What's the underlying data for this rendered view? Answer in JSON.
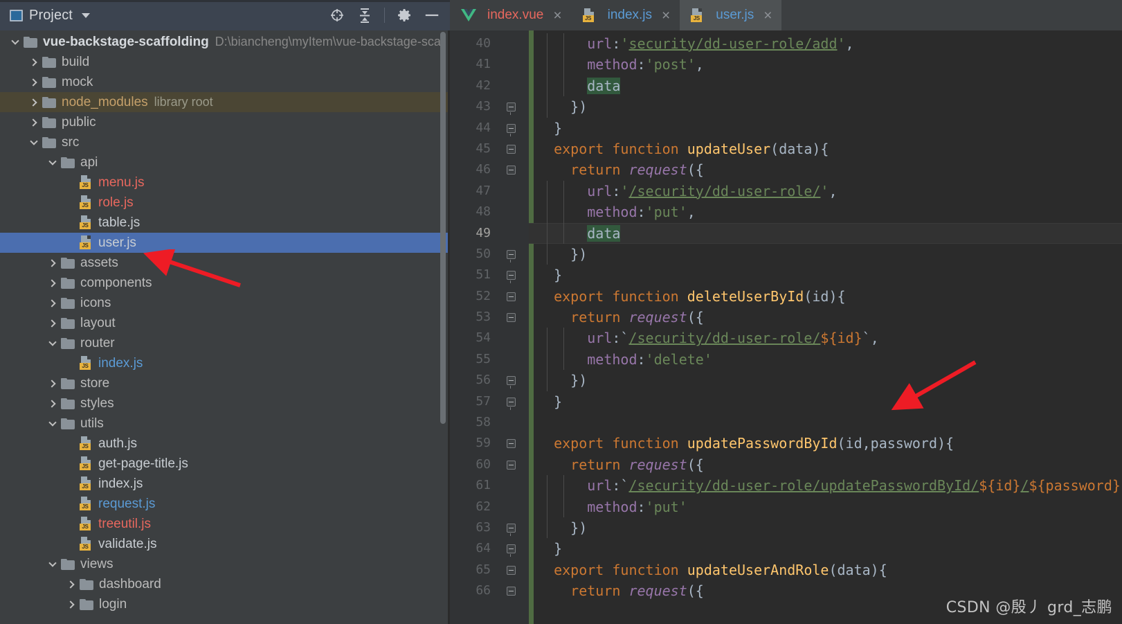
{
  "panel": {
    "title": "Project",
    "icons": {
      "project_icon": "project-icon",
      "dropdown": "chevron-down-icon",
      "locate": "locate-target-icon",
      "collapse_all": "collapse-all-icon",
      "settings": "gear-icon",
      "hide": "minimize-icon"
    }
  },
  "tree": [
    {
      "depth": 0,
      "arrow": "down",
      "icon": "folder",
      "label": "vue-backstage-scaffolding",
      "bold": true,
      "sub": "D:\\biancheng\\myItem\\vue-backstage-sca",
      "color": "white"
    },
    {
      "depth": 1,
      "arrow": "right",
      "icon": "folder",
      "label": "build",
      "color": "plain"
    },
    {
      "depth": 1,
      "arrow": "right",
      "icon": "folder",
      "label": "mock",
      "color": "plain"
    },
    {
      "depth": 1,
      "arrow": "right",
      "icon": "folder",
      "label": "node_modules",
      "color": "yellow",
      "sub": "library root",
      "highlight": "libroot"
    },
    {
      "depth": 1,
      "arrow": "right",
      "icon": "folder",
      "label": "public",
      "color": "plain"
    },
    {
      "depth": 1,
      "arrow": "down",
      "icon": "folder",
      "label": "src",
      "color": "plain"
    },
    {
      "depth": 2,
      "arrow": "down",
      "icon": "folder",
      "label": "api",
      "color": "plain"
    },
    {
      "depth": 3,
      "arrow": "none",
      "icon": "js",
      "label": "menu.js",
      "color": "red"
    },
    {
      "depth": 3,
      "arrow": "none",
      "icon": "js",
      "label": "role.js",
      "color": "red"
    },
    {
      "depth": 3,
      "arrow": "none",
      "icon": "js",
      "label": "table.js",
      "color": "white"
    },
    {
      "depth": 3,
      "arrow": "none",
      "icon": "js",
      "label": "user.js",
      "color": "white",
      "selected": true
    },
    {
      "depth": 2,
      "arrow": "right",
      "icon": "folder",
      "label": "assets",
      "color": "plain"
    },
    {
      "depth": 2,
      "arrow": "right",
      "icon": "folder",
      "label": "components",
      "color": "plain"
    },
    {
      "depth": 2,
      "arrow": "right",
      "icon": "folder",
      "label": "icons",
      "color": "plain"
    },
    {
      "depth": 2,
      "arrow": "right",
      "icon": "folder",
      "label": "layout",
      "color": "plain"
    },
    {
      "depth": 2,
      "arrow": "down",
      "icon": "folder",
      "label": "router",
      "color": "plain"
    },
    {
      "depth": 3,
      "arrow": "none",
      "icon": "js",
      "label": "index.js",
      "color": "blue"
    },
    {
      "depth": 2,
      "arrow": "right",
      "icon": "folder",
      "label": "store",
      "color": "plain"
    },
    {
      "depth": 2,
      "arrow": "right",
      "icon": "folder",
      "label": "styles",
      "color": "plain"
    },
    {
      "depth": 2,
      "arrow": "down",
      "icon": "folder",
      "label": "utils",
      "color": "plain"
    },
    {
      "depth": 3,
      "arrow": "none",
      "icon": "js",
      "label": "auth.js",
      "color": "white"
    },
    {
      "depth": 3,
      "arrow": "none",
      "icon": "js",
      "label": "get-page-title.js",
      "color": "white"
    },
    {
      "depth": 3,
      "arrow": "none",
      "icon": "js",
      "label": "index.js",
      "color": "white"
    },
    {
      "depth": 3,
      "arrow": "none",
      "icon": "js",
      "label": "request.js",
      "color": "blue"
    },
    {
      "depth": 3,
      "arrow": "none",
      "icon": "js",
      "label": "treeutil.js",
      "color": "red"
    },
    {
      "depth": 3,
      "arrow": "none",
      "icon": "js",
      "label": "validate.js",
      "color": "white"
    },
    {
      "depth": 2,
      "arrow": "down",
      "icon": "folder",
      "label": "views",
      "color": "plain"
    },
    {
      "depth": 3,
      "arrow": "right",
      "icon": "folder",
      "label": "dashboard",
      "color": "plain"
    },
    {
      "depth": 3,
      "arrow": "right",
      "icon": "folder",
      "label": "login",
      "color": "plain"
    }
  ],
  "tabs": [
    {
      "label": "index.vue",
      "icon": "vue-icon",
      "color": "red",
      "active": false,
      "close": "×"
    },
    {
      "label": "index.js",
      "icon": "js-icon",
      "color": "blue",
      "active": false,
      "close": "×"
    },
    {
      "label": "user.js",
      "icon": "js-icon",
      "color": "blue",
      "active": true,
      "close": "×"
    }
  ],
  "editor": {
    "first_line": 40,
    "current_line": 49,
    "lines": [
      {
        "n": 40,
        "indent": 3,
        "fold": "none",
        "guides": [
          1,
          2
        ],
        "tokens": [
          {
            "t": "url",
            "c": "prop"
          },
          {
            "t": ":",
            "c": "plain"
          },
          {
            "t": "'",
            "c": "str"
          },
          {
            "t": "security/dd-user-role/add",
            "c": "link"
          },
          {
            "t": "'",
            "c": "str"
          },
          {
            "t": ",",
            "c": "plain"
          }
        ]
      },
      {
        "n": 41,
        "indent": 3,
        "fold": "none",
        "guides": [
          1,
          2
        ],
        "tokens": [
          {
            "t": "method",
            "c": "prop"
          },
          {
            "t": ":",
            "c": "plain"
          },
          {
            "t": "'post'",
            "c": "str"
          },
          {
            "t": ",",
            "c": "plain"
          }
        ]
      },
      {
        "n": 42,
        "indent": 3,
        "fold": "none",
        "guides": [
          1,
          2
        ],
        "tokens": [
          {
            "t": "data",
            "c": "hl"
          }
        ]
      },
      {
        "n": 43,
        "indent": 2,
        "fold": "bracket",
        "guides": [
          1
        ],
        "tokens": [
          {
            "t": "})",
            "c": "plain"
          }
        ]
      },
      {
        "n": 44,
        "indent": 1,
        "fold": "bracket",
        "guides": [],
        "tokens": [
          {
            "t": "}",
            "c": "plain"
          }
        ]
      },
      {
        "n": 45,
        "indent": 1,
        "fold": "plain",
        "guides": [],
        "tokens": [
          {
            "t": "export function ",
            "c": "key"
          },
          {
            "t": "updateUser",
            "c": "fn"
          },
          {
            "t": "(data){",
            "c": "plain"
          }
        ]
      },
      {
        "n": 46,
        "indent": 2,
        "fold": "plain",
        "guides": [],
        "tokens": [
          {
            "t": "return ",
            "c": "key"
          },
          {
            "t": "request",
            "c": "italic"
          },
          {
            "t": "({",
            "c": "plain"
          }
        ]
      },
      {
        "n": 47,
        "indent": 3,
        "fold": "none",
        "guides": [
          1,
          2
        ],
        "tokens": [
          {
            "t": "url",
            "c": "prop"
          },
          {
            "t": ":",
            "c": "plain"
          },
          {
            "t": "'",
            "c": "str"
          },
          {
            "t": "/security/dd-user-role/",
            "c": "link"
          },
          {
            "t": "'",
            "c": "str"
          },
          {
            "t": ",",
            "c": "plain"
          }
        ]
      },
      {
        "n": 48,
        "indent": 3,
        "fold": "none",
        "guides": [
          1,
          2
        ],
        "tokens": [
          {
            "t": "method",
            "c": "prop"
          },
          {
            "t": ":",
            "c": "plain"
          },
          {
            "t": "'put'",
            "c": "str"
          },
          {
            "t": ",",
            "c": "plain"
          }
        ]
      },
      {
        "n": 49,
        "indent": 3,
        "fold": "none",
        "guides": [
          1,
          2
        ],
        "current": true,
        "tokens": [
          {
            "t": "data",
            "c": "hl"
          }
        ]
      },
      {
        "n": 50,
        "indent": 2,
        "fold": "bracket",
        "guides": [
          1
        ],
        "tokens": [
          {
            "t": "})",
            "c": "plain"
          }
        ]
      },
      {
        "n": 51,
        "indent": 1,
        "fold": "bracket",
        "guides": [],
        "tokens": [
          {
            "t": "}",
            "c": "plain"
          }
        ]
      },
      {
        "n": 52,
        "indent": 1,
        "fold": "plain",
        "guides": [],
        "tokens": [
          {
            "t": "export function ",
            "c": "key"
          },
          {
            "t": "deleteUserById",
            "c": "fn"
          },
          {
            "t": "(id){",
            "c": "plain"
          }
        ]
      },
      {
        "n": 53,
        "indent": 2,
        "fold": "plain",
        "guides": [],
        "tokens": [
          {
            "t": "return ",
            "c": "key"
          },
          {
            "t": "request",
            "c": "italic"
          },
          {
            "t": "({",
            "c": "plain"
          }
        ]
      },
      {
        "n": 54,
        "indent": 3,
        "fold": "none",
        "guides": [
          1,
          2
        ],
        "tokens": [
          {
            "t": "url",
            "c": "prop"
          },
          {
            "t": ":`",
            "c": "plain"
          },
          {
            "t": "/security/dd-user-role/",
            "c": "link"
          },
          {
            "t": "${id}",
            "c": "tmplvar"
          },
          {
            "t": "`",
            "c": "plain"
          },
          {
            "t": ",",
            "c": "plain"
          }
        ]
      },
      {
        "n": 55,
        "indent": 3,
        "fold": "none",
        "guides": [
          1,
          2
        ],
        "tokens": [
          {
            "t": "method",
            "c": "prop"
          },
          {
            "t": ":",
            "c": "plain"
          },
          {
            "t": "'delete'",
            "c": "str"
          }
        ]
      },
      {
        "n": 56,
        "indent": 2,
        "fold": "bracket",
        "guides": [
          1
        ],
        "tokens": [
          {
            "t": "})",
            "c": "plain"
          }
        ]
      },
      {
        "n": 57,
        "indent": 1,
        "fold": "bracket",
        "guides": [],
        "tokens": [
          {
            "t": "}",
            "c": "plain"
          }
        ]
      },
      {
        "n": 58,
        "indent": 0,
        "fold": "none",
        "guides": [],
        "tokens": []
      },
      {
        "n": 59,
        "indent": 1,
        "fold": "plain",
        "guides": [],
        "tokens": [
          {
            "t": "export function ",
            "c": "key"
          },
          {
            "t": "updatePasswordById",
            "c": "fn"
          },
          {
            "t": "(id,password){",
            "c": "plain"
          }
        ]
      },
      {
        "n": 60,
        "indent": 2,
        "fold": "plain",
        "guides": [],
        "tokens": [
          {
            "t": "return ",
            "c": "key"
          },
          {
            "t": "request",
            "c": "italic"
          },
          {
            "t": "({",
            "c": "plain"
          }
        ]
      },
      {
        "n": 61,
        "indent": 3,
        "fold": "none",
        "guides": [
          1,
          2
        ],
        "tokens": [
          {
            "t": "url",
            "c": "prop"
          },
          {
            "t": ":`",
            "c": "plain"
          },
          {
            "t": "/security/dd-user-role/updatePasswordById/",
            "c": "link"
          },
          {
            "t": "${id}",
            "c": "tmplvar"
          },
          {
            "t": "/",
            "c": "link"
          },
          {
            "t": "${password}",
            "c": "tmplvar"
          },
          {
            "t": "`",
            "c": "plain"
          },
          {
            "t": ",",
            "c": "plain"
          }
        ]
      },
      {
        "n": 62,
        "indent": 3,
        "fold": "none",
        "guides": [
          1,
          2
        ],
        "tokens": [
          {
            "t": "method",
            "c": "prop"
          },
          {
            "t": ":",
            "c": "plain"
          },
          {
            "t": "'put'",
            "c": "str"
          }
        ]
      },
      {
        "n": 63,
        "indent": 2,
        "fold": "bracket",
        "guides": [
          1
        ],
        "tokens": [
          {
            "t": "})",
            "c": "plain"
          }
        ]
      },
      {
        "n": 64,
        "indent": 1,
        "fold": "bracket",
        "guides": [],
        "tokens": [
          {
            "t": "}",
            "c": "plain"
          }
        ]
      },
      {
        "n": 65,
        "indent": 1,
        "fold": "plain",
        "guides": [],
        "tokens": [
          {
            "t": "export function ",
            "c": "key"
          },
          {
            "t": "updateUserAndRole",
            "c": "fn"
          },
          {
            "t": "(data){",
            "c": "plain"
          }
        ]
      },
      {
        "n": 66,
        "indent": 2,
        "fold": "plain",
        "guides": [],
        "tokens": [
          {
            "t": "return ",
            "c": "key"
          },
          {
            "t": "request",
            "c": "italic"
          },
          {
            "t": "({",
            "c": "plain"
          }
        ]
      }
    ]
  },
  "annotations": [
    {
      "name": "arrow-to-user-js",
      "color": "#ee1c25"
    },
    {
      "name": "arrow-to-code",
      "color": "#ee1c25"
    }
  ],
  "watermark": "CSDN @殷丿  grd_志鹏",
  "colors": {
    "accent_selection": "#4b6eaf",
    "library_root": "#4b4634",
    "keyword": "#cc7832",
    "function": "#ffc66d",
    "string": "#6a8759",
    "property": "#9876aa",
    "annotation_red": "#ee1c25"
  }
}
